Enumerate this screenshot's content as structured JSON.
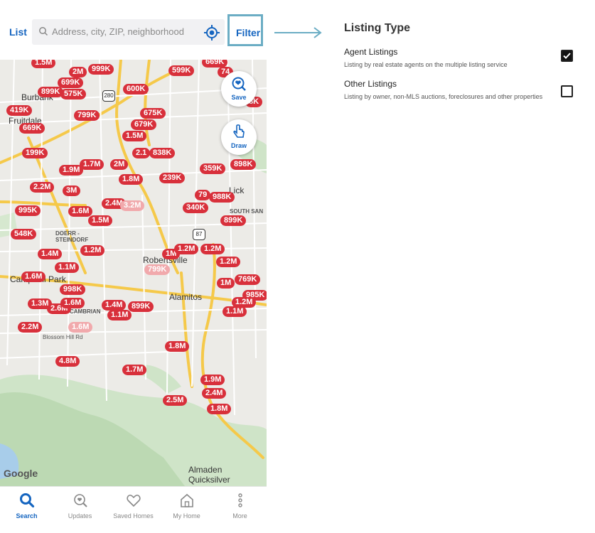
{
  "header": {
    "list_label": "List",
    "search_placeholder": "Address, city, ZIP, neighborhood",
    "filter_label": "Filter"
  },
  "map": {
    "save_label": "Save",
    "draw_label": "Draw",
    "attribution": "Google",
    "places": [
      "Burbank",
      "Fruitdale",
      "Doerr - Steindorf",
      "Robertsville",
      "Campbell Park",
      "Cambrian",
      "Alamitos",
      "South San",
      "Lick",
      "Blossom Hill Rd",
      "Almaden Quicksilver"
    ],
    "shields": [
      "280",
      "87"
    ],
    "pins": [
      "1.5M",
      "2M",
      "999K",
      "699K",
      "575K",
      "899K",
      "419K",
      "669K",
      "799K",
      "600K",
      "675K",
      "679K",
      "1.5M",
      "2.1",
      "838K",
      "199K",
      "1.9M",
      "1.7M",
      "2M",
      "1.8M",
      "239K",
      "2.2M",
      "3M",
      "2.4M",
      "3.2M",
      "995K",
      "1.6M",
      "1.5M",
      "548K",
      "1.4M",
      "1.2M",
      "1.1M",
      "1.6M",
      "998K",
      "1.3M",
      "2.6M",
      "1.6M",
      "2.2M",
      "1.6M",
      "4.8M",
      "1.4M",
      "899K",
      "1.1M",
      "1M",
      "1.2M",
      "1.2M",
      "799K",
      "599K",
      "669K",
      "74",
      "8K",
      "359K",
      "898K",
      "79",
      "988K",
      "340K",
      "899K",
      "1.2M",
      "1M",
      "769K",
      "985K",
      "1.2M",
      "1.1M",
      "1.8M",
      "1.7M",
      "1.9M",
      "2.4M",
      "2.5M",
      "1.8M"
    ]
  },
  "bottom_nav": [
    "Search",
    "Updates",
    "Saved Homes",
    "My Home",
    "More"
  ],
  "filter_panel": {
    "title": "Listing Type",
    "options": [
      {
        "title": "Agent Listings",
        "description": "Listing by real estate agents on the multiple listing service",
        "checked": true
      },
      {
        "title": "Other Listings",
        "description": "Listing by owner, non-MLS auctions, foreclosures and other properties",
        "checked": false
      }
    ]
  },
  "colors": {
    "accent": "#1565c0",
    "pin": "#d8303b",
    "pin_faded": "#f1a9ac",
    "callout": "#6badc4"
  }
}
